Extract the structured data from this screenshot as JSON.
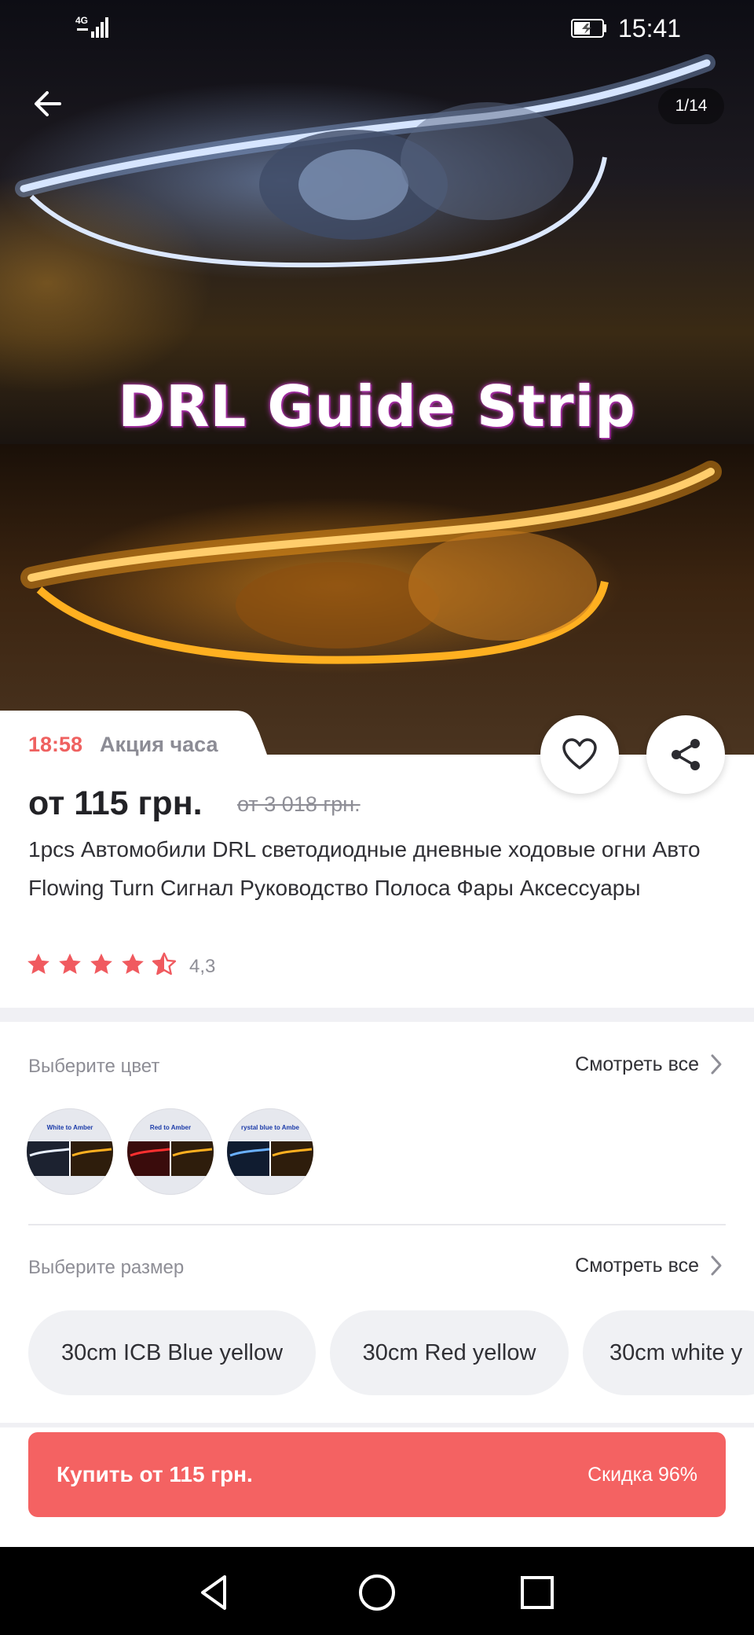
{
  "status_bar": {
    "network": "4G",
    "time": "15:41"
  },
  "gallery": {
    "counter": "1/14",
    "caption": "DRL Guide Strip"
  },
  "promo": {
    "timer": "18:58",
    "label": "Акция часа"
  },
  "product": {
    "price": "от 115 грн.",
    "old_price": "от 3 018 грн.",
    "title": "1pcs Автомобили DRL светодиодные дневные ходовые огни Авто Flowing Turn Сигнал Руководство Полоса Фары Аксессуары",
    "rating": "4,3",
    "rating_stars": 4.3
  },
  "color_select": {
    "label": "Выберите цвет",
    "see_all": "Смотреть все",
    "swatches": [
      {
        "text": "White to Amber"
      },
      {
        "text": "Red to Amber"
      },
      {
        "text": "rystal blue to Ambe"
      }
    ]
  },
  "size_select": {
    "label": "Выберите размер",
    "see_all": "Смотреть все",
    "options": [
      {
        "label": "30cm ICB Blue yellow"
      },
      {
        "label": "30cm Red yellow"
      },
      {
        "label": "30cm white y"
      }
    ]
  },
  "buy_bar": {
    "label": "Купить от 115 грн.",
    "discount": "Скидка 96%"
  },
  "colors": {
    "accent": "#f46262",
    "timer": "#ef6160",
    "star": "#f05a5f"
  },
  "icons": {
    "back": "arrow-left-icon",
    "favorite": "heart-icon",
    "share": "share-icon",
    "chevron": "chevron-right-icon",
    "star": "star-icon"
  }
}
